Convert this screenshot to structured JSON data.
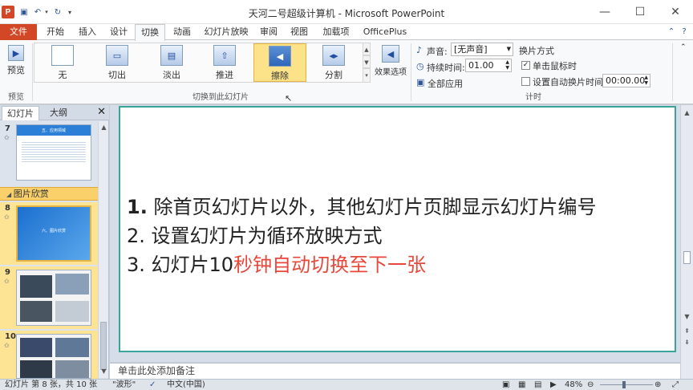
{
  "window": {
    "title": "天河二号超级计算机 - Microsoft PowerPoint",
    "app_icon": "P",
    "minimize": "—",
    "maximize": "☐",
    "close": "✕"
  },
  "tabs": [
    "文件",
    "开始",
    "插入",
    "设计",
    "切换",
    "动画",
    "幻灯片放映",
    "审阅",
    "视图",
    "加载项",
    "OfficePlus"
  ],
  "ribbon": {
    "preview_label": "预览",
    "preview_group": "预览",
    "transitions": [
      "无",
      "切出",
      "淡出",
      "推进",
      "擦除",
      "分割"
    ],
    "transitions_group": "切换到此幻灯片",
    "effect_options": "效果选项",
    "sound_label": "声音:",
    "sound_value": "[无声音]",
    "duration_label": "持续时间:",
    "duration_value": "01.00",
    "apply_all": "全部应用",
    "advance_heading": "换片方式",
    "on_click": "单击鼠标时",
    "auto_after": "设置自动换片时间:",
    "auto_value": "00:00.00",
    "timing_group": "计时"
  },
  "left_pane": {
    "tab_slides": "幻灯片",
    "tab_outline": "大纲",
    "section": "图片欣赏",
    "slides": [
      "7",
      "8",
      "9",
      "10"
    ],
    "slide7_title": "五、应用领域",
    "slide8_title": "六、图片欣赏"
  },
  "slide": {
    "line1_num": "1.",
    "line1_text": "除首页幻灯片以外，其他幻灯片页脚显示幻灯片编号",
    "line2": "2. 设置幻灯片为循环放映方式",
    "line3_black": "3. 幻灯片10",
    "line3_red": "秒钟自动切换至下一张"
  },
  "notes_placeholder": "单击此处添加备注",
  "status": {
    "slide_info": "幻灯片 第 8 张，共 10 张",
    "theme": "\"波形\"",
    "language": "中文(中国)",
    "zoom": "48%"
  },
  "colors": {
    "file_tab": "#d24726",
    "slide_border": "#3aa39a",
    "highlight": "#e8483b",
    "selected": "#fce38a"
  }
}
